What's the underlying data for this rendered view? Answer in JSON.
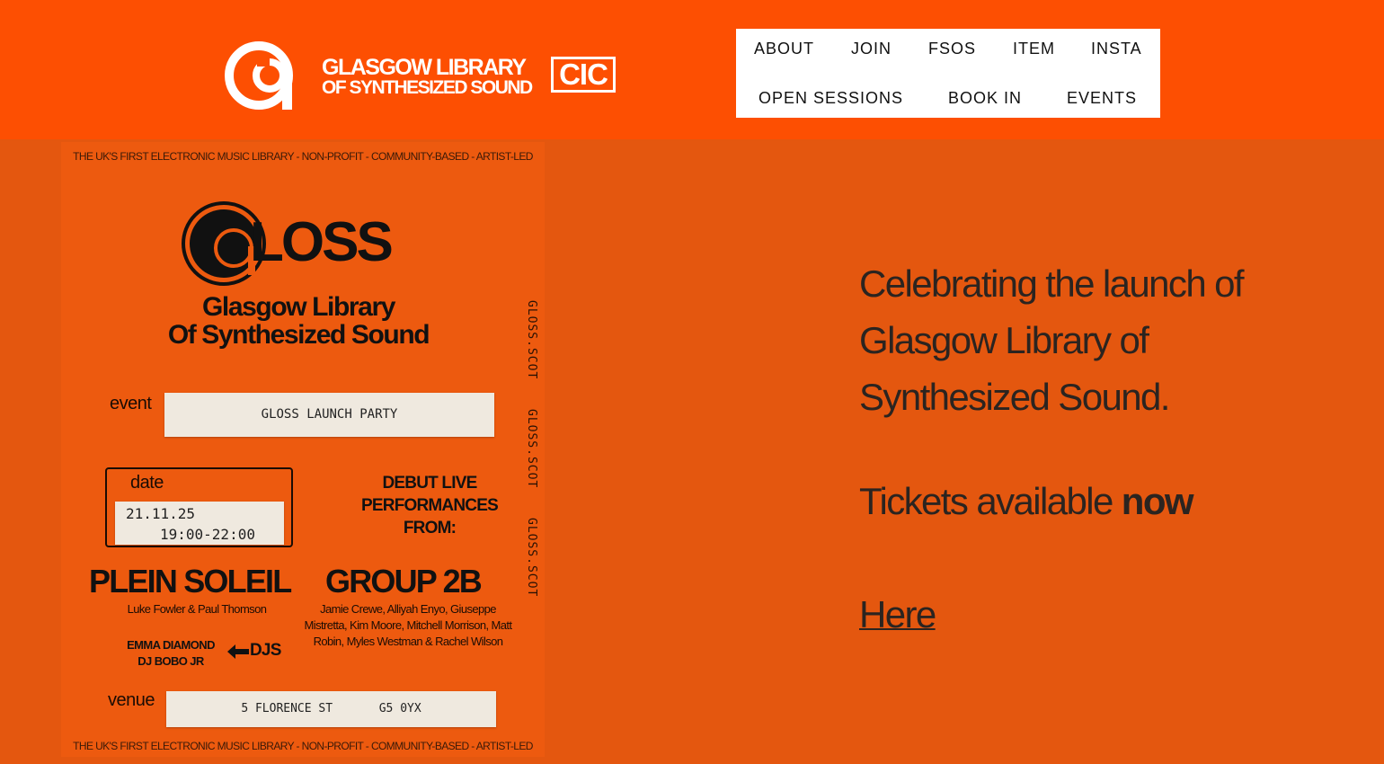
{
  "header": {
    "logo_line1": "GLASGOW LIBRARY",
    "logo_line2": "OF SYNTHESIZED SOUND",
    "logo_badge": "CIC"
  },
  "nav": {
    "items": [
      {
        "label": "ABOUT"
      },
      {
        "label": "JOIN"
      },
      {
        "label": "FSOS"
      },
      {
        "label": "ITEM"
      },
      {
        "label": "INSTA"
      },
      {
        "label": "OPEN SESSIONS"
      },
      {
        "label": "BOOK IN"
      },
      {
        "label": "EVENTS"
      }
    ]
  },
  "poster": {
    "strapline": "THE UK'S FIRST ELECTRONIC MUSIC LIBRARY - NON-PROFIT - COMMUNITY-BASED - ARTIST-LED",
    "gloss_word": "LOSS",
    "subtitle_line1": "Glasgow Library",
    "subtitle_line2": "Of Synthesized Sound",
    "side_text": "GLOSS.SCOT",
    "event_label": "event",
    "event_value": "GLOSS LAUNCH PARTY",
    "date_label": "date",
    "date_value": "21.11.25",
    "time_value": "19:00-22:00",
    "debut_line1": "DEBUT LIVE",
    "debut_line2": "PERFORMANCES",
    "debut_line3": "FROM:",
    "act1_name": "PLEIN SOLEIL",
    "act1_members": "Luke Fowler & Paul Thomson",
    "act2_name": "GROUP 2B",
    "act2_members": "Jamie Crewe, Alliyah Enyo, Giuseppe Mistretta, Kim Moore, Mitchell Morrison, Matt Robin, Myles Westman & Rachel Wilson",
    "dj1": "EMMA DIAMOND",
    "dj2": "DJ BOBO JR",
    "djs_label": "DJS",
    "venue_label": "venue",
    "venue_street": "5 FLORENCE ST",
    "venue_postcode": "G5 0YX"
  },
  "main": {
    "intro": "Celebrating the launch of Glasgow Library of Synthesized Sound.",
    "tickets_prefix": "Tickets available ",
    "tickets_emphasis": "now",
    "link_label": "Here"
  },
  "colors": {
    "header_bg": "#fd4f02",
    "page_bg": "#e4570f",
    "poster_bg": "#ed5a0f",
    "text": "#2b2420"
  }
}
